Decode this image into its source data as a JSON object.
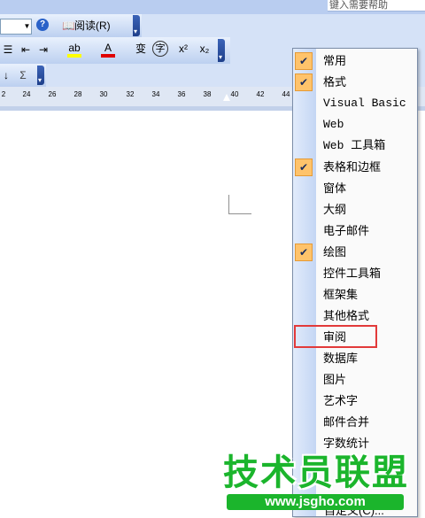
{
  "help": {
    "placeholder": "键入需要帮助"
  },
  "toolbar": {
    "read_label": "阅读(R)",
    "highlight_label": "ab",
    "font_color_label": "A",
    "phonetic_label": "变",
    "enclose_label": "字",
    "superscript_label": "x²",
    "subscript_label": "x₂",
    "sum_label": "Σ"
  },
  "ruler": {
    "ticks": [
      "2",
      "24",
      "26",
      "28",
      "30",
      "32",
      "34",
      "36",
      "38",
      "40",
      "42",
      "44"
    ]
  },
  "menu": {
    "items": [
      {
        "label": "常用",
        "checked": true
      },
      {
        "label": "格式",
        "checked": true
      },
      {
        "label": "Visual Basic",
        "checked": false
      },
      {
        "label": "Web",
        "checked": false
      },
      {
        "label": "Web 工具箱",
        "checked": false
      },
      {
        "label": "表格和边框",
        "checked": true
      },
      {
        "label": "窗体",
        "checked": false
      },
      {
        "label": "大纲",
        "checked": false
      },
      {
        "label": "电子邮件",
        "checked": false
      },
      {
        "label": "绘图",
        "checked": true
      },
      {
        "label": "控件工具箱",
        "checked": false
      },
      {
        "label": "框架集",
        "checked": false
      },
      {
        "label": "其他格式",
        "checked": false
      },
      {
        "label": "审阅",
        "checked": false
      },
      {
        "label": "数据库",
        "checked": false
      },
      {
        "label": "图片",
        "checked": false
      },
      {
        "label": "艺术字",
        "checked": false
      },
      {
        "label": "邮件合并",
        "checked": false
      },
      {
        "label": "字数统计",
        "checked": false
      }
    ],
    "last_item": "自定义(C)..."
  },
  "watermark": {
    "title": "技术员联盟",
    "url": "www.jsgho.com"
  },
  "colors": {
    "checked_bg": "#ffc36b",
    "highlight_border": "#e23a3a",
    "watermark": "#1bb52c"
  }
}
